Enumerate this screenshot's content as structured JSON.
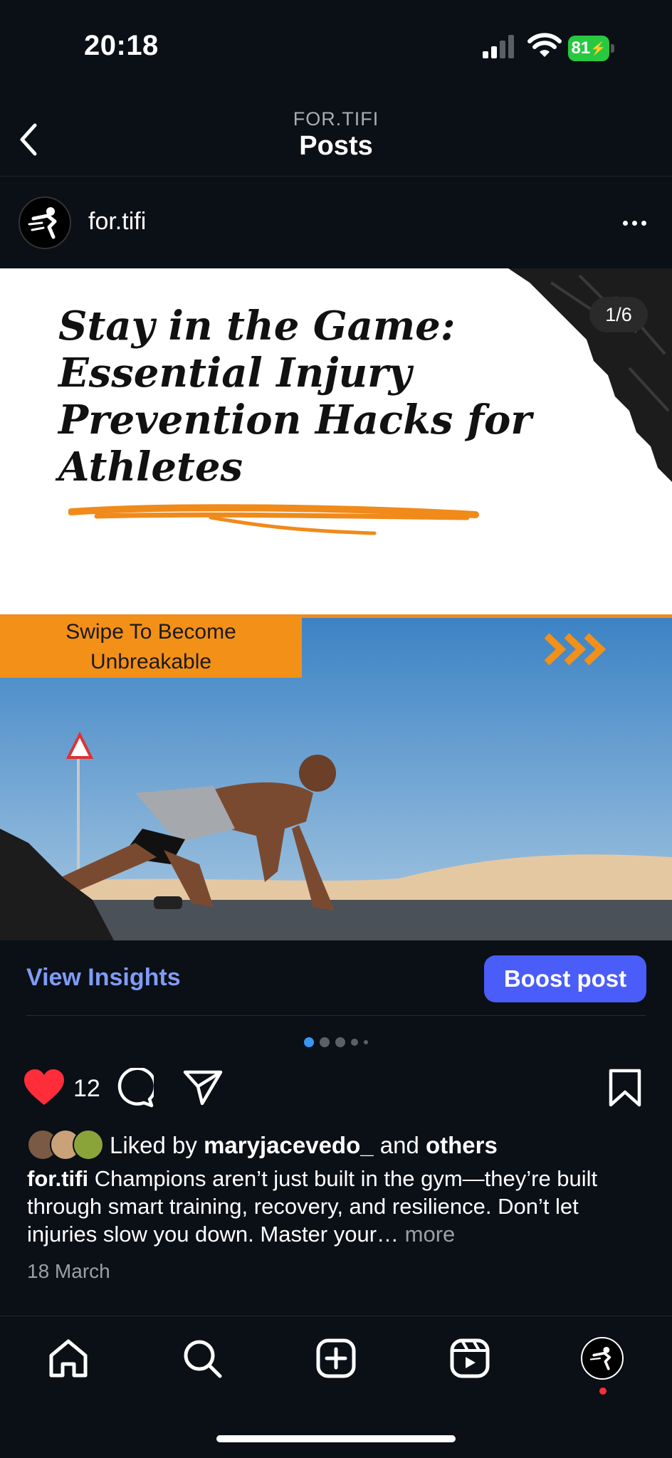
{
  "status_bar": {
    "time": "20:18",
    "battery": "81"
  },
  "header": {
    "account": "FOR.TIFI",
    "title": "Posts"
  },
  "post": {
    "username": "for.tifi",
    "slide": {
      "title_lines": [
        "Stay in the Game:",
        "Essential Injury",
        "Prevention Hacks for",
        "Athletes"
      ],
      "counter": "1/6",
      "swipe_lines": [
        "Swipe To Become",
        "Unbreakable"
      ],
      "arrows": ">>>"
    },
    "insights_label": "View Insights",
    "boost_label": "Boost post",
    "like_count": "12",
    "liked_by_prefix": "Liked by ",
    "liked_by_user": "maryjacevedo_",
    "liked_by_mid": " and ",
    "liked_by_others": "others",
    "caption_user": "for.tifi",
    "caption_text": " Champions aren’t just built in the gym—they’re built through smart training, recovery, and resilience. Don’t let injuries slow you down. Master your…",
    "caption_more": " more",
    "date": "18 March"
  },
  "colors": {
    "background": "#0b0f16",
    "accent_blue": "#4a5df9",
    "insights_blue": "#7f9cf5",
    "like_red": "#ff2d3a",
    "slide_orange": "#f39018"
  },
  "icons": {
    "back": "chevron-left-icon",
    "more": "ellipsis-icon",
    "like": "heart-icon",
    "comment": "comment-icon",
    "share": "paper-plane-icon",
    "save": "bookmark-icon",
    "nav": [
      "home-icon",
      "search-icon",
      "create-icon",
      "reels-icon",
      "profile-avatar"
    ]
  }
}
